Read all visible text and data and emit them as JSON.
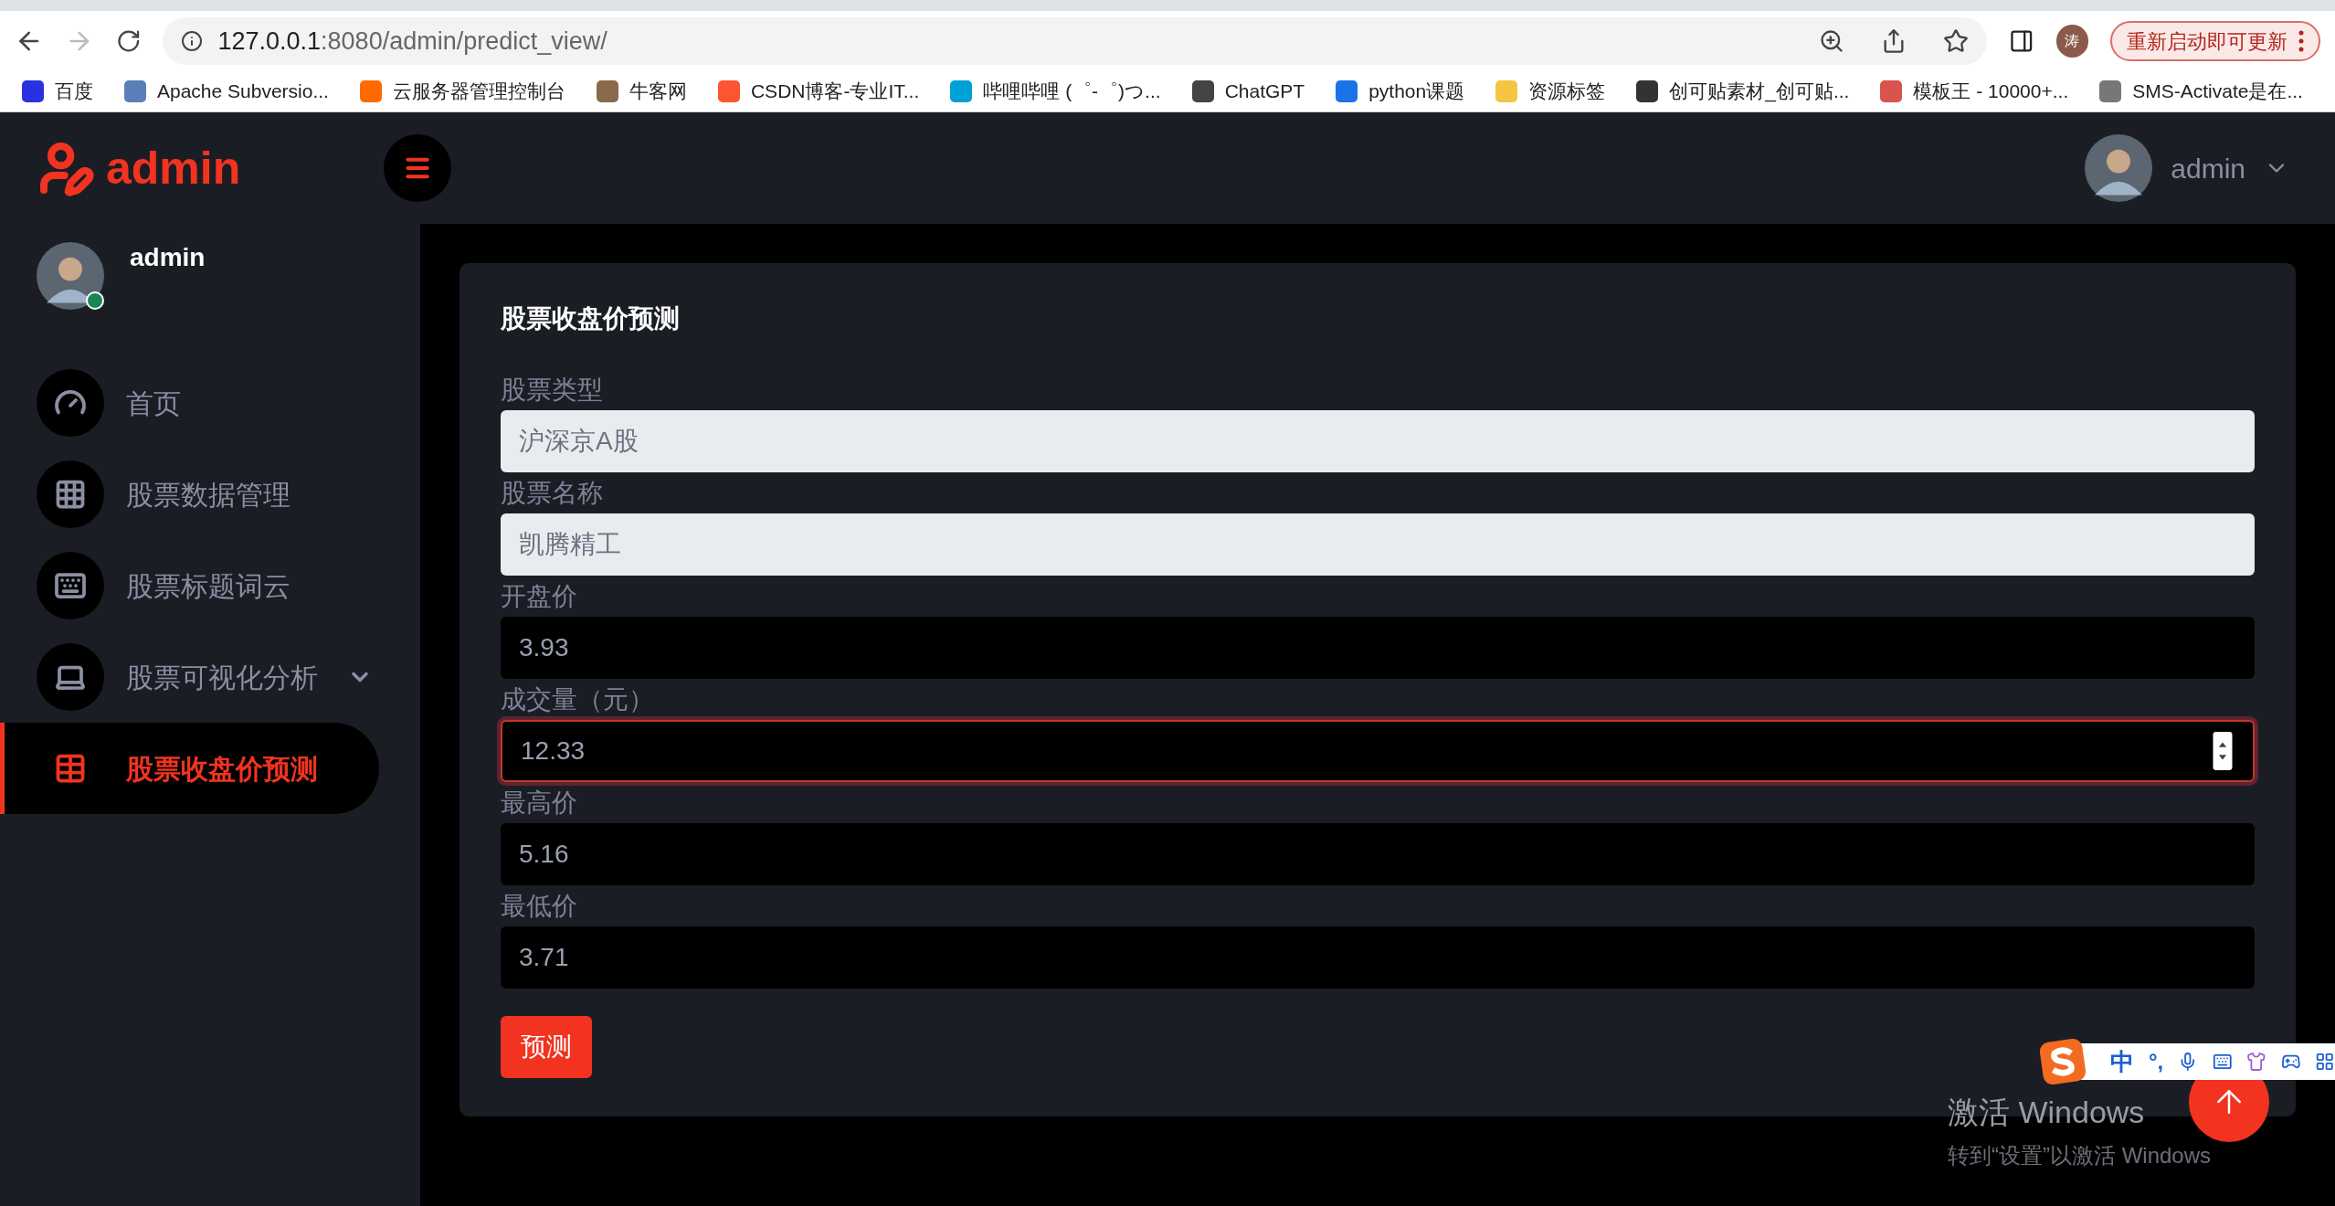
{
  "browser": {
    "url_host": "127.0.0.1",
    "url_rest": ":8080/admin/predict_view/",
    "profile_initial": "涛",
    "update_button": "重新启动即可更新",
    "bookmarks": [
      {
        "label": "百度",
        "color": "#2932e1"
      },
      {
        "label": "Apache Subversio...",
        "color": "#5a7fb8"
      },
      {
        "label": "云服务器管理控制台",
        "color": "#ff6a00"
      },
      {
        "label": "牛客网",
        "color": "#8a6a4a"
      },
      {
        "label": "CSDN博客-专业IT...",
        "color": "#fc5531"
      },
      {
        "label": "哔哩哔哩 (゜-゜)つ...",
        "color": "#00a1d6"
      },
      {
        "label": "ChatGPT",
        "color": "#444444"
      },
      {
        "label": "python课题",
        "color": "#1a73e8"
      },
      {
        "label": "资源标签",
        "color": "#f4c542"
      },
      {
        "label": "创可贴素材_创可贴...",
        "color": "#333333"
      },
      {
        "label": "模板王 - 10000+...",
        "color": "#d9534f"
      },
      {
        "label": "SMS-Activate是在...",
        "color": "#777777"
      }
    ]
  },
  "header": {
    "logo": "admin",
    "user": "admin"
  },
  "sidebar": {
    "user": {
      "name": "admin",
      "online": true
    },
    "items": [
      {
        "label": "首页",
        "selected": false,
        "expandable": false
      },
      {
        "label": "股票数据管理",
        "selected": false,
        "expandable": false
      },
      {
        "label": "股票标题词云",
        "selected": false,
        "expandable": false
      },
      {
        "label": "股票可视化分析",
        "selected": false,
        "expandable": true
      },
      {
        "label": "股票收盘价预测",
        "selected": true,
        "expandable": false
      }
    ]
  },
  "form": {
    "title": "股票收盘价预测",
    "fields": [
      {
        "label": "股票类型",
        "value": "沪深京A股",
        "kind": "readonly",
        "focused": false
      },
      {
        "label": "股票名称",
        "value": "凯腾精工",
        "kind": "readonly",
        "focused": false
      },
      {
        "label": "开盘价",
        "value": "3.93",
        "kind": "number",
        "focused": false
      },
      {
        "label": "成交量（元）",
        "value": "12.33",
        "kind": "number",
        "focused": true
      },
      {
        "label": "最高价",
        "value": "5.16",
        "kind": "number",
        "focused": false
      },
      {
        "label": "最低价",
        "value": "3.71",
        "kind": "number",
        "focused": false
      }
    ],
    "submit": "预测"
  },
  "ime_toolbar": {
    "mode": "中",
    "punct": "°,"
  },
  "activation": {
    "title": "激活 Windows",
    "subtitle": "转到“设置”以激活 Windows"
  }
}
